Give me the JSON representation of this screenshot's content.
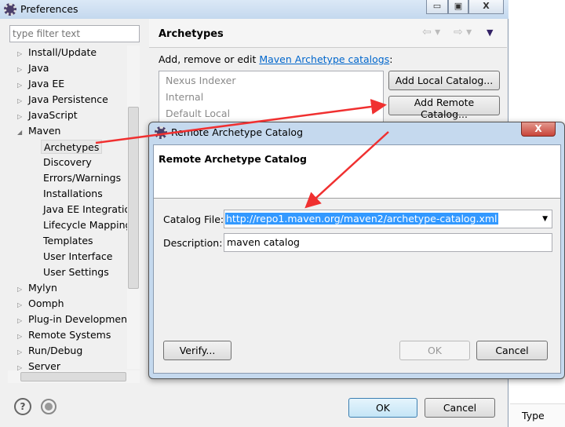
{
  "prefs": {
    "title": "Preferences",
    "filter_placeholder": "type filter text",
    "tree": [
      {
        "label": "Install/Update"
      },
      {
        "label": "Java"
      },
      {
        "label": "Java EE"
      },
      {
        "label": "Java Persistence"
      },
      {
        "label": "JavaScript"
      },
      {
        "label": "Maven",
        "expanded": true
      },
      {
        "label": "Mylyn"
      },
      {
        "label": "Oomph"
      },
      {
        "label": "Plug-in Development"
      },
      {
        "label": "Remote Systems"
      },
      {
        "label": "Run/Debug"
      },
      {
        "label": "Server"
      }
    ],
    "maven_children": [
      "Archetypes",
      "Discovery",
      "Errors/Warnings",
      "Installations",
      "Java EE Integration",
      "Lifecycle Mapping",
      "Templates",
      "User Interface",
      "User Settings"
    ],
    "selected": "Archetypes",
    "page_title": "Archetypes",
    "description_prefix": "Add, remove or edit ",
    "description_link": "Maven Archetype catalogs",
    "description_suffix": ":",
    "catalogs": [
      "Nexus Indexer",
      "Internal",
      "Default Local"
    ],
    "add_local": "Add Local Catalog...",
    "add_remote": "Add Remote Catalog...",
    "ok": "OK",
    "cancel": "Cancel",
    "window_buttons": {
      "minimize": "▭",
      "maximize": "▣",
      "close": "X"
    }
  },
  "background": {
    "type_column": "Type"
  },
  "dialog": {
    "title": "Remote Archetype Catalog",
    "heading": "Remote Archetype Catalog",
    "catalog_label": "Catalog File:",
    "catalog_value": "http://repo1.maven.org/maven2/archetype-catalog.xml",
    "description_label": "Description:",
    "description_value": "maven catalog",
    "verify": "Verify...",
    "ok": "OK",
    "cancel": "Cancel",
    "close": "X"
  },
  "colors": {
    "selection": "#3399ff",
    "link": "#0066cc",
    "arrow": "#f03030",
    "close_button": "#c9453a"
  }
}
